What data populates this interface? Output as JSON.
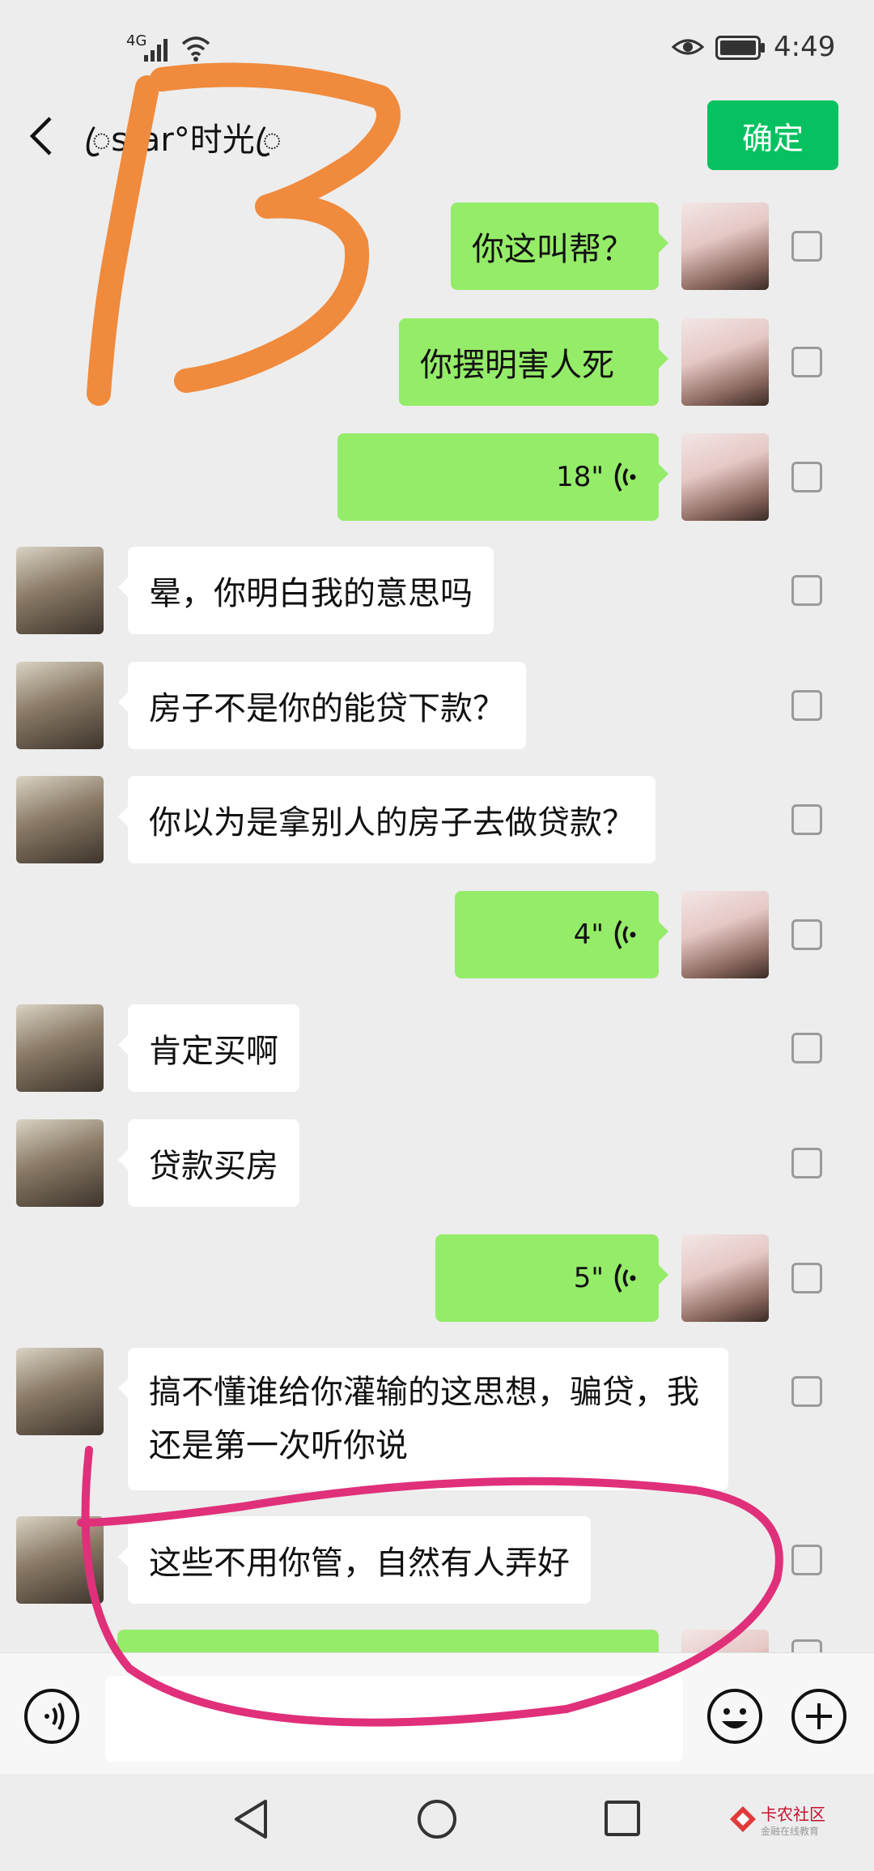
{
  "status_bar": {
    "network": "4G",
    "time": "4:49"
  },
  "header": {
    "title": "ꦿstar°时光ꦿ",
    "confirm_label": "确定"
  },
  "messages": [
    {
      "side": "out",
      "type": "text",
      "text": "你这叫帮？"
    },
    {
      "side": "out",
      "type": "text",
      "text": "你摆明害人死"
    },
    {
      "side": "out",
      "type": "voice",
      "duration": "18\""
    },
    {
      "side": "in",
      "type": "text",
      "text": "晕，你明白我的意思吗"
    },
    {
      "side": "in",
      "type": "text",
      "text": "房子不是你的能贷下款？"
    },
    {
      "side": "in",
      "type": "text",
      "text": "你以为是拿别人的房子去做贷款？"
    },
    {
      "side": "out",
      "type": "voice",
      "duration": "4\""
    },
    {
      "side": "in",
      "type": "text",
      "text": "肯定买啊"
    },
    {
      "side": "in",
      "type": "text",
      "text": "贷款买房"
    },
    {
      "side": "out",
      "type": "voice",
      "duration": "5\""
    },
    {
      "side": "in",
      "type": "text",
      "text": "搞不懂谁给你灌输的这思想，骗贷，我还是第一次听你说"
    },
    {
      "side": "in",
      "type": "text",
      "text": "这些不用你管，自然有人弄好"
    }
  ],
  "annotation": {
    "number": "13",
    "color": "#f08a3c",
    "circle_color": "#e0307a"
  },
  "watermark": {
    "name": "卡农社区",
    "sub": "金融在线教育"
  },
  "colors": {
    "accent": "#07c160",
    "outgoing_bubble": "#95ec69",
    "incoming_bubble": "#ffffff",
    "background": "#ededed"
  }
}
